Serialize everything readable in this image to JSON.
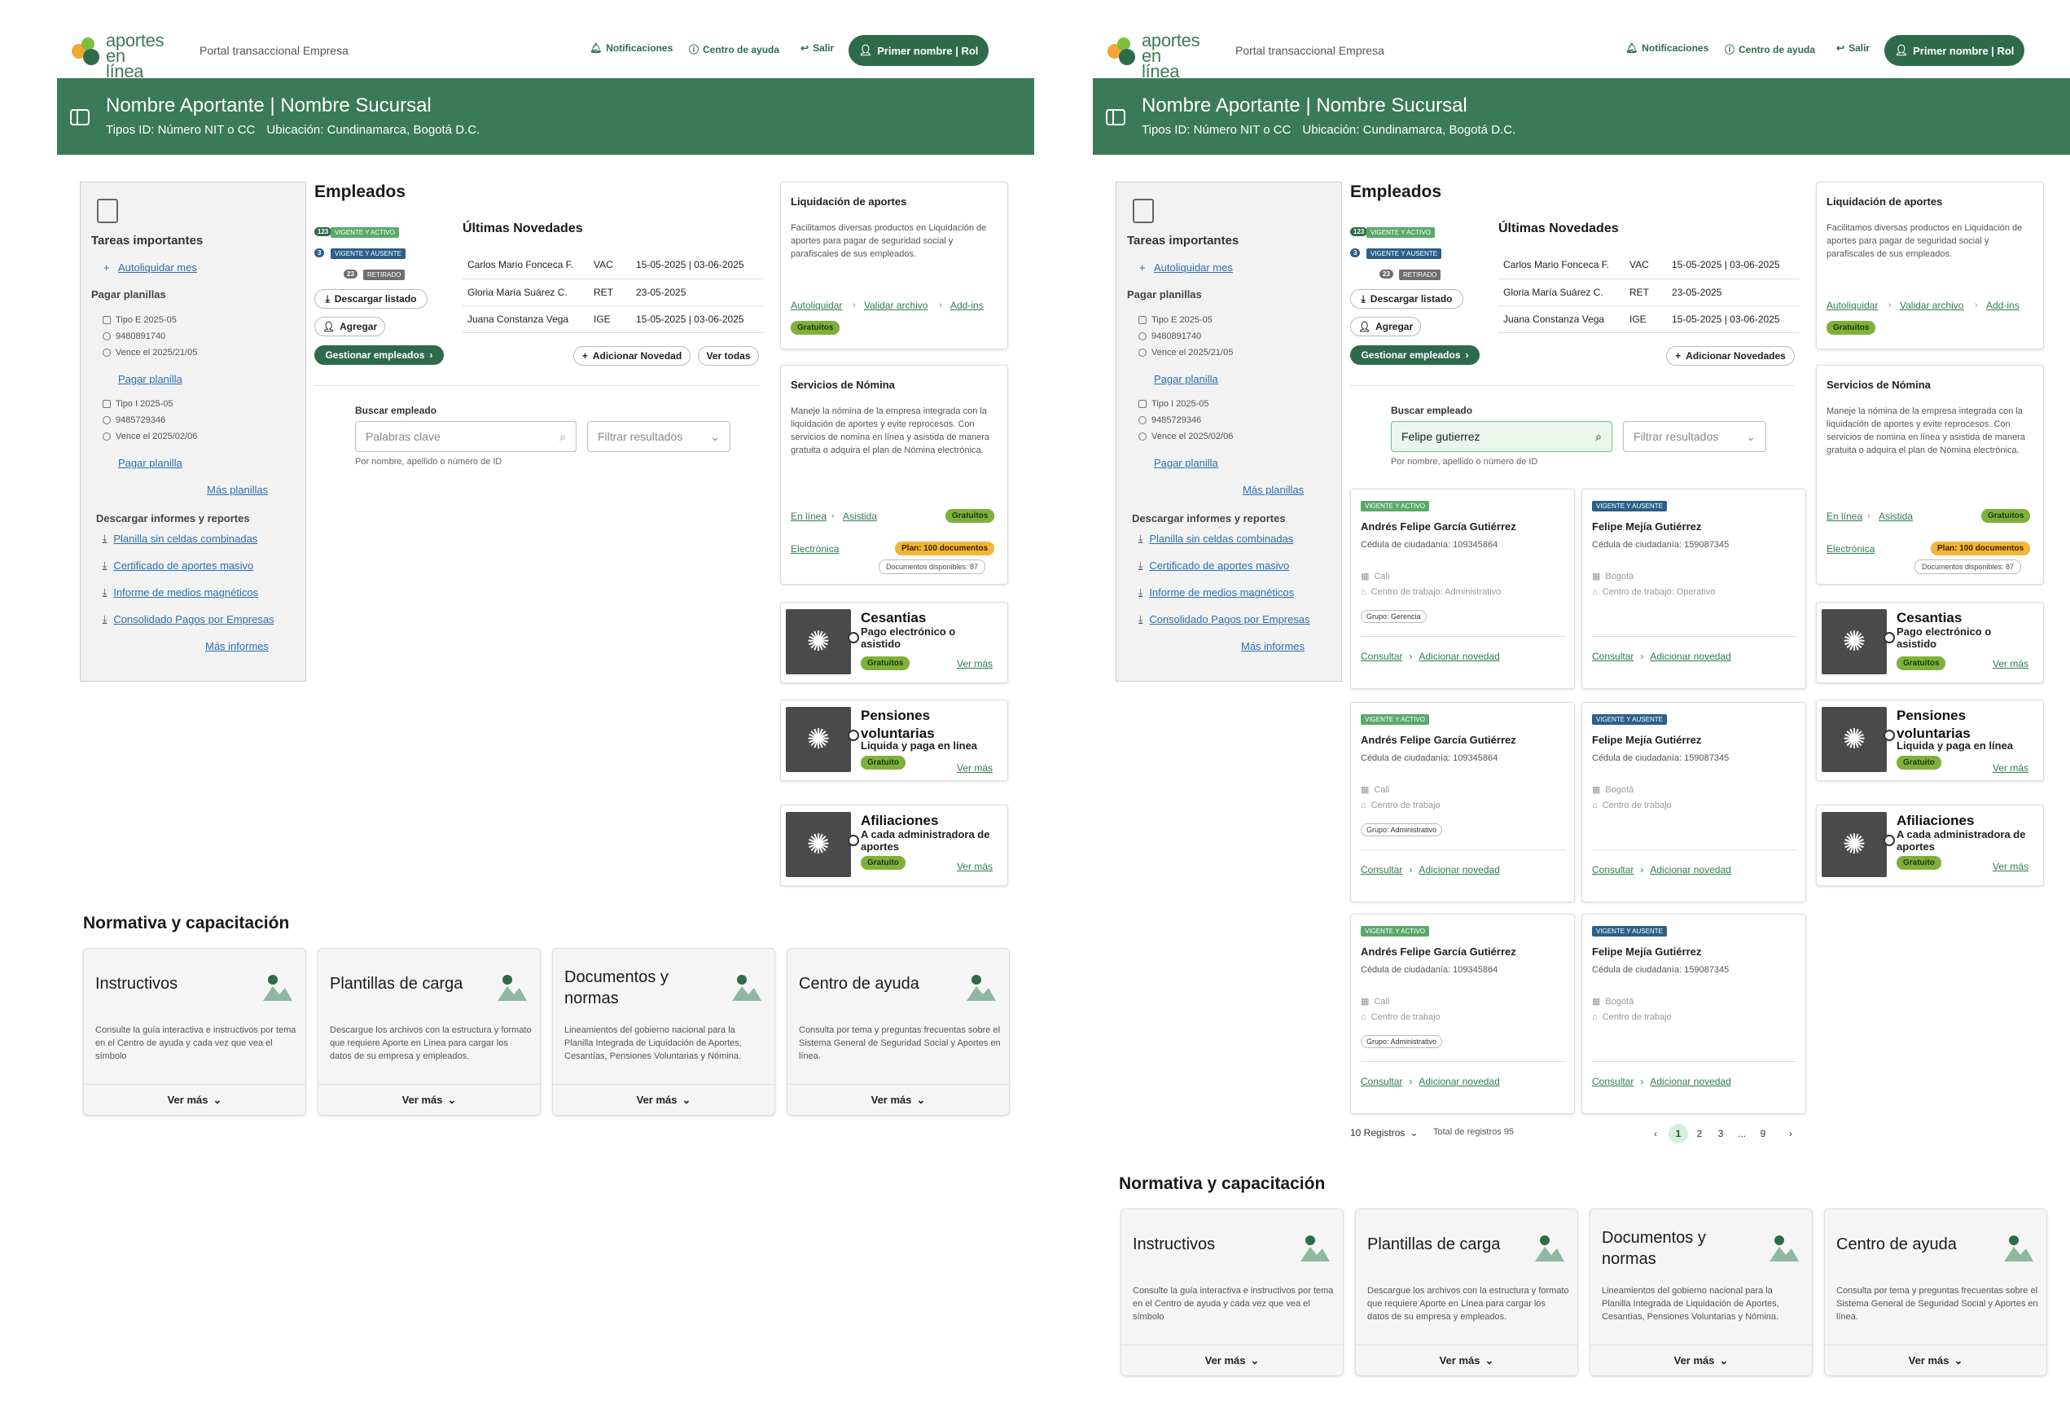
{
  "header": {
    "logo_line1": "aportes",
    "logo_line2": "en línea",
    "portal": "Portal transaccional Empresa",
    "notifications": "Notificaciones",
    "help": "Centro de ayuda",
    "logout": "Salir",
    "user": "Primer nombre | Rol"
  },
  "banner": {
    "title": "Nombre Aportante | Nombre Sucursal",
    "id_types": "Tipos ID: Número NIT o CC",
    "location": "Ubicación: Cundinamarca, Bogotá D.C."
  },
  "tasks": {
    "title": "Tareas importantes",
    "autoliquidar": "Autoliquidar mes",
    "pagar_title": "Pagar planillas",
    "planilla1": {
      "tipo": "Tipo E 2025-05",
      "num": "9480891740",
      "vence": "Vence el 2025/21/05",
      "link": "Pagar planilla"
    },
    "planilla2": {
      "tipo": "Tipo I 2025-05",
      "num": "9485729346",
      "vence": "Vence el 2025/02/06",
      "link": "Pagar planilla"
    },
    "mas_planillas": "Más planillas",
    "informes_title": "Descargar informes y reportes",
    "informes": [
      "Planilla sin celdas combinadas",
      "Certificado de aportes masivo",
      "Informe de medios magnéticos",
      "Consolidado Pagos por Empresas"
    ],
    "mas_informes": "Más informes"
  },
  "empleados": {
    "title": "Empleados",
    "status": [
      {
        "count": "123",
        "label": "VIGENTE Y ACTIVO"
      },
      {
        "count": "3",
        "label": "VIGENTE Y AUSENTE"
      },
      {
        "count": "23",
        "label": "RETIRADO"
      }
    ],
    "descargar": "Descargar listado",
    "agregar": "Agregar",
    "gestionar": "Gestionar empleados",
    "novedades_title": "Últimas Novedades",
    "novedades": [
      [
        "Carlos Mario Fonceca F.",
        "VAC",
        "15-05-2025 | 03-06-2025"
      ],
      [
        "Gloria María Suárez C.",
        "RET",
        "23-05-2025"
      ],
      [
        "Juana Constanza Vega",
        "IGE",
        "15-05-2025 | 03-06-2025"
      ]
    ],
    "adicionar_novedad": "Adicionar Novedad",
    "adicionar_novedades": "Adicionar Novedades",
    "ver_todas": "Ver todas",
    "buscar_label": "Buscar empleado",
    "buscar_placeholder": "Palabras clave",
    "buscar_value": "Felipe gutierrez",
    "filtrar": "Filtrar resultados",
    "buscar_hint": "Por nombre, apellido o número de ID"
  },
  "liquidacion": {
    "title": "Liquidación de aportes",
    "desc": "Facilitamos diversas productos en Liquidación de aportes para pagar de seguridad social y parafiscales de sus empleados.",
    "links": [
      "Autoliquidar",
      "Validar archivo",
      "Add-ins"
    ],
    "badge": "Gratuitos"
  },
  "nomina": {
    "title": "Servicios de Nómina",
    "desc": "Maneje la nómina de la empresa integrada con la liquidación de aportes y evite reprocesos. Con servicios de nomina en línea y asistida de manera gratuita o adquira el plan de Nómina electrónica.",
    "link1": "En línea",
    "link2": "Asistida",
    "badge1": "Gratuitos",
    "link3": "Electrónica",
    "badge2": "Plan: 100 documentos",
    "badge3": "Documentos disponibles: 87"
  },
  "productos": [
    {
      "title": "Cesantias",
      "sub": "Pago electrónico o asistido",
      "badge": "Gratuitos",
      "link": "Ver más"
    },
    {
      "title": "Pensiones voluntarias",
      "sub": "Liquida y paga en línea",
      "badge": "Gratuito",
      "link": "Ver más"
    },
    {
      "title": "Afiliaciones",
      "sub": "A cada administradora de aportes",
      "badge": "Gratuito",
      "link": "Ver más"
    }
  ],
  "normativa": {
    "title": "Normativa y capacitación",
    "cards": [
      {
        "title": "Instructivos",
        "desc": "Consulte la guía interactiva e instructivos por tema en el Centro de ayuda y cada vez que vea el símbolo",
        "more": "Ver más"
      },
      {
        "title": "Plantillas de carga",
        "desc": "Descargue los archivos con la estructura y formato que requiere Aporte en Línea para cargar los datos de su empresa y empleados.",
        "more": "Ver más"
      },
      {
        "title": "Documentos y normas",
        "desc": "Lineamientos del gobierno nacional para la Planilla Integrada de Liquidación de Aportes, Cesantías, Pensiones Voluntarias y Nómina.",
        "more": "Ver más"
      },
      {
        "title": "Centro de ayuda",
        "desc": "Consulta por tema y preguntas frecuentas sobre el Sistema General de Seguridad Social y Aportes en línea.",
        "more": "Ver más"
      }
    ]
  },
  "resultados": [
    {
      "badge": "VIGENTE Y ACTIVO",
      "name": "Andrés Felipe García Gutiérrez",
      "id": "Cédula de ciudadanía: 109345864",
      "city": "Cali",
      "center": "Centro de trabajo: Administrativo",
      "group": "Grupo: Gerencia",
      "consultar": "Consultar",
      "adicionar": "Adicionar novedad"
    },
    {
      "badge": "VIGENTE Y AUSENTE",
      "name": "Felipe Mejía Gutiérrez",
      "id": "Cédula de ciudadanía: 159087345",
      "city": "Bogotá",
      "center": "Centro de trabajo: Operativo",
      "group": "",
      "consultar": "Consultar",
      "adicionar": "Adicionar novedad"
    },
    {
      "badge": "VIGENTE Y ACTIVO",
      "name": "Andrés Felipe García Gutiérrez",
      "id": "Cédula de ciudadanía: 109345864",
      "city": "Cali",
      "center": "Centro de trabajo",
      "group": "Grupo: Administrativo",
      "consultar": "Consultar",
      "adicionar": "Adicionar novedad"
    },
    {
      "badge": "VIGENTE Y AUSENTE",
      "name": "Felipe Mejía Gutiérrez",
      "id": "Cédula de ciudadanía: 159087345",
      "city": "Bogotá",
      "center": "Centro de trabajo",
      "group": "",
      "consultar": "Consultar",
      "adicionar": "Adicionar novedad"
    },
    {
      "badge": "VIGENTE Y ACTIVO",
      "name": "Andrés Felipe García Gutiérrez",
      "id": "Cédula de ciudadanía: 109345864",
      "city": "Cali",
      "center": "Centro de trabajo",
      "group": "Grupo: Administrativo",
      "consultar": "Consultar",
      "adicionar": "Adicionar novedad"
    },
    {
      "badge": "VIGENTE Y AUSENTE",
      "name": "Felipe Mejía Gutiérrez",
      "id": "Cédula de ciudadanía: 159087345",
      "city": "Bogotá",
      "center": "Centro de trabajo",
      "group": "",
      "consultar": "Consultar",
      "adicionar": "Adicionar novedad"
    }
  ],
  "paginacion": {
    "per_page": "10 Registros",
    "total": "Total de registros 95",
    "pages": [
      "1",
      "2",
      "3",
      "...",
      "9"
    ]
  },
  "colors": {
    "primary": "#2e6b4b",
    "banner": "#3b7a57",
    "badge_active": "#5aa96a",
    "badge_absent": "#2c5f8a",
    "badge_retired": "#6e6e6e",
    "free": "#7fb13a",
    "plan": "#f2b53a"
  }
}
